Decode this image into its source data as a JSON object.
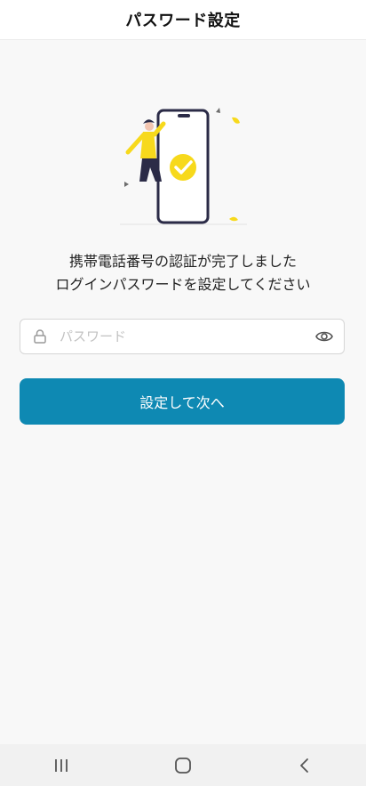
{
  "header": {
    "title": "パスワード設定"
  },
  "message": {
    "line1": "携帯電話番号の認証が完了しました",
    "line2": "ログインパスワードを設定してください"
  },
  "password": {
    "placeholder": "パスワード",
    "value": "",
    "lock_icon": "lock-icon",
    "eye_icon": "eye-icon"
  },
  "submit": {
    "label": "設定して次へ"
  },
  "navbar": {
    "items": [
      "recent-apps-icon",
      "home-icon",
      "back-icon"
    ]
  },
  "colors": {
    "accent": "#0e89b3",
    "illustration_yellow": "#f7d91c",
    "phone_outline": "#2b2b47"
  }
}
